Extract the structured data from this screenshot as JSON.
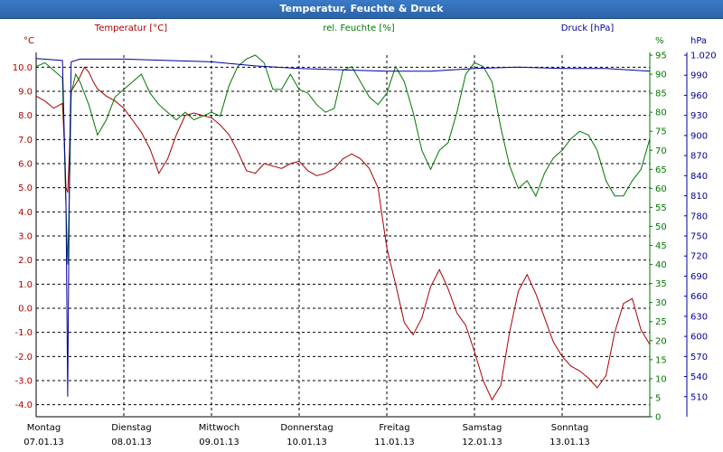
{
  "window": {
    "title": "Temperatur, Feuchte & Druck"
  },
  "colors": {
    "temp": "#aa0000",
    "hum": "#007700",
    "press": "#000099",
    "grid": "#000000",
    "axis": "#000000"
  },
  "chart_data": {
    "type": "line",
    "title": "Temperatur, Feuchte & Druck",
    "x_range": [
      0,
      7
    ],
    "x_ticks": [
      {
        "x": 0,
        "day": "Montag",
        "date": "07.01.13"
      },
      {
        "x": 1,
        "day": "Dienstag",
        "date": "08.01.13"
      },
      {
        "x": 2,
        "day": "Mittwoch",
        "date": "09.01.13"
      },
      {
        "x": 3,
        "day": "Donnerstag",
        "date": "10.01.13"
      },
      {
        "x": 4,
        "day": "Freitag",
        "date": "11.01.13"
      },
      {
        "x": 5,
        "day": "Samstag",
        "date": "12.01.13"
      },
      {
        "x": 6,
        "day": "Sonntag",
        "date": "13.01.13"
      }
    ],
    "axes": {
      "temp": {
        "label": "Temperatur [°C]",
        "unit": "°C",
        "ylim": [
          -4.5,
          10.5
        ],
        "ticks": [
          "10.0",
          "9.0",
          "8.0",
          "7.0",
          "6.0",
          "5.0",
          "4.0",
          "3.0",
          "2.0",
          "1.0",
          "0.0",
          "-1.0",
          "-2.0",
          "-3.0",
          "-4.0"
        ]
      },
      "hum": {
        "label": "rel. Feuchte [%]",
        "unit": "%",
        "ylim": [
          0,
          95
        ],
        "ticks": [
          "95",
          "90",
          "85",
          "80",
          "75",
          "70",
          "65",
          "60",
          "55",
          "50",
          "45",
          "40",
          "35",
          "30",
          "25",
          "20",
          "15",
          "10",
          "5",
          "0"
        ]
      },
      "press": {
        "label": "Druck [hPa]",
        "unit": "hPa",
        "ylim": [
          480,
          1020
        ],
        "ticks": [
          "1.020",
          "990",
          "960",
          "930",
          "900",
          "870",
          "840",
          "810",
          "780",
          "750",
          "720",
          "690",
          "660",
          "630",
          "600",
          "570",
          "540",
          "510"
        ]
      }
    },
    "series": [
      {
        "name": "Temperatur [°C]",
        "axis": "temp",
        "x": [
          0,
          0.1,
          0.2,
          0.3,
          0.32,
          0.34,
          0.36,
          0.38,
          0.4,
          0.45,
          0.5,
          0.55,
          0.6,
          0.65,
          0.7,
          0.8,
          0.9,
          1.0,
          1.1,
          1.2,
          1.3,
          1.4,
          1.5,
          1.6,
          1.7,
          1.8,
          1.9,
          2.0,
          2.1,
          2.2,
          2.3,
          2.4,
          2.5,
          2.6,
          2.7,
          2.8,
          2.9,
          3.0,
          3.1,
          3.2,
          3.3,
          3.4,
          3.5,
          3.6,
          3.7,
          3.8,
          3.9,
          4.0,
          4.1,
          4.2,
          4.3,
          4.4,
          4.5,
          4.6,
          4.7,
          4.8,
          4.9,
          5.0,
          5.1,
          5.2,
          5.3,
          5.4,
          5.5,
          5.6,
          5.7,
          5.8,
          5.9,
          6.0,
          6.1,
          6.2,
          6.3,
          6.4,
          6.5,
          6.6,
          6.7,
          6.8,
          6.9,
          7.0
        ],
        "values": [
          8.8,
          8.6,
          8.3,
          8.5,
          7.0,
          5.0,
          4.8,
          6.5,
          9.0,
          9.3,
          9.6,
          10.0,
          9.8,
          9.4,
          9.1,
          8.8,
          8.6,
          8.3,
          7.8,
          7.3,
          6.6,
          5.6,
          6.2,
          7.2,
          8.0,
          8.1,
          8.0,
          7.9,
          7.6,
          7.2,
          6.5,
          5.7,
          5.6,
          6.0,
          5.9,
          5.8,
          6.0,
          6.1,
          5.7,
          5.5,
          5.6,
          5.8,
          6.2,
          6.4,
          6.2,
          5.8,
          5.0,
          2.5,
          1.0,
          -0.6,
          -1.1,
          -0.4,
          0.9,
          1.6,
          0.8,
          -0.2,
          -0.7,
          -1.8,
          -3.0,
          -3.8,
          -3.2,
          -1.0,
          0.7,
          1.4,
          0.6,
          -0.4,
          -1.4,
          -2.0,
          -2.4,
          -2.6,
          -2.9,
          -3.3,
          -2.8,
          -1.0,
          0.2,
          0.4,
          -0.9,
          -1.5
        ]
      },
      {
        "name": "rel. Feuchte [%]",
        "axis": "hum",
        "x": [
          0,
          0.1,
          0.2,
          0.3,
          0.34,
          0.36,
          0.38,
          0.4,
          0.45,
          0.5,
          0.6,
          0.7,
          0.8,
          0.9,
          1.0,
          1.1,
          1.2,
          1.3,
          1.4,
          1.5,
          1.6,
          1.7,
          1.8,
          1.9,
          2.0,
          2.1,
          2.2,
          2.3,
          2.4,
          2.5,
          2.6,
          2.7,
          2.8,
          2.9,
          3.0,
          3.1,
          3.2,
          3.3,
          3.4,
          3.5,
          3.6,
          3.7,
          3.8,
          3.9,
          4.0,
          4.1,
          4.2,
          4.3,
          4.4,
          4.5,
          4.6,
          4.7,
          4.8,
          4.9,
          5.0,
          5.1,
          5.2,
          5.3,
          5.4,
          5.5,
          5.6,
          5.7,
          5.8,
          5.9,
          6.0,
          6.1,
          6.2,
          6.3,
          6.4,
          6.5,
          6.6,
          6.7,
          6.8,
          6.9,
          7.0
        ],
        "values": [
          92,
          93,
          91,
          89,
          55,
          40,
          60,
          85,
          90,
          88,
          82,
          74,
          78,
          84,
          86,
          88,
          90,
          85,
          82,
          80,
          78,
          80,
          78,
          79,
          80,
          79,
          87,
          92,
          94,
          95,
          93,
          86,
          86,
          90,
          86,
          85,
          82,
          80,
          81,
          91,
          92,
          88,
          84,
          82,
          85,
          92,
          88,
          80,
          70,
          65,
          70,
          72,
          80,
          90,
          93,
          92,
          88,
          76,
          66,
          60,
          62,
          58,
          64,
          68,
          70,
          73,
          75,
          74,
          70,
          62,
          58,
          58,
          62,
          65,
          73
        ]
      },
      {
        "name": "Druck [hPa]",
        "axis": "press",
        "x": [
          0,
          0.3,
          0.34,
          0.36,
          0.38,
          0.4,
          0.5,
          1.0,
          1.5,
          2.0,
          2.5,
          3.0,
          3.5,
          4.0,
          4.5,
          5.0,
          5.5,
          6.0,
          6.5,
          7.0
        ],
        "values": [
          1015,
          1012,
          800,
          510,
          850,
          1010,
          1014,
          1014,
          1012,
          1010,
          1004,
          1000,
          998,
          996,
          996,
          1000,
          1002,
          1000,
          1000,
          996
        ]
      }
    ],
    "grid": true,
    "legend": "top-center"
  }
}
